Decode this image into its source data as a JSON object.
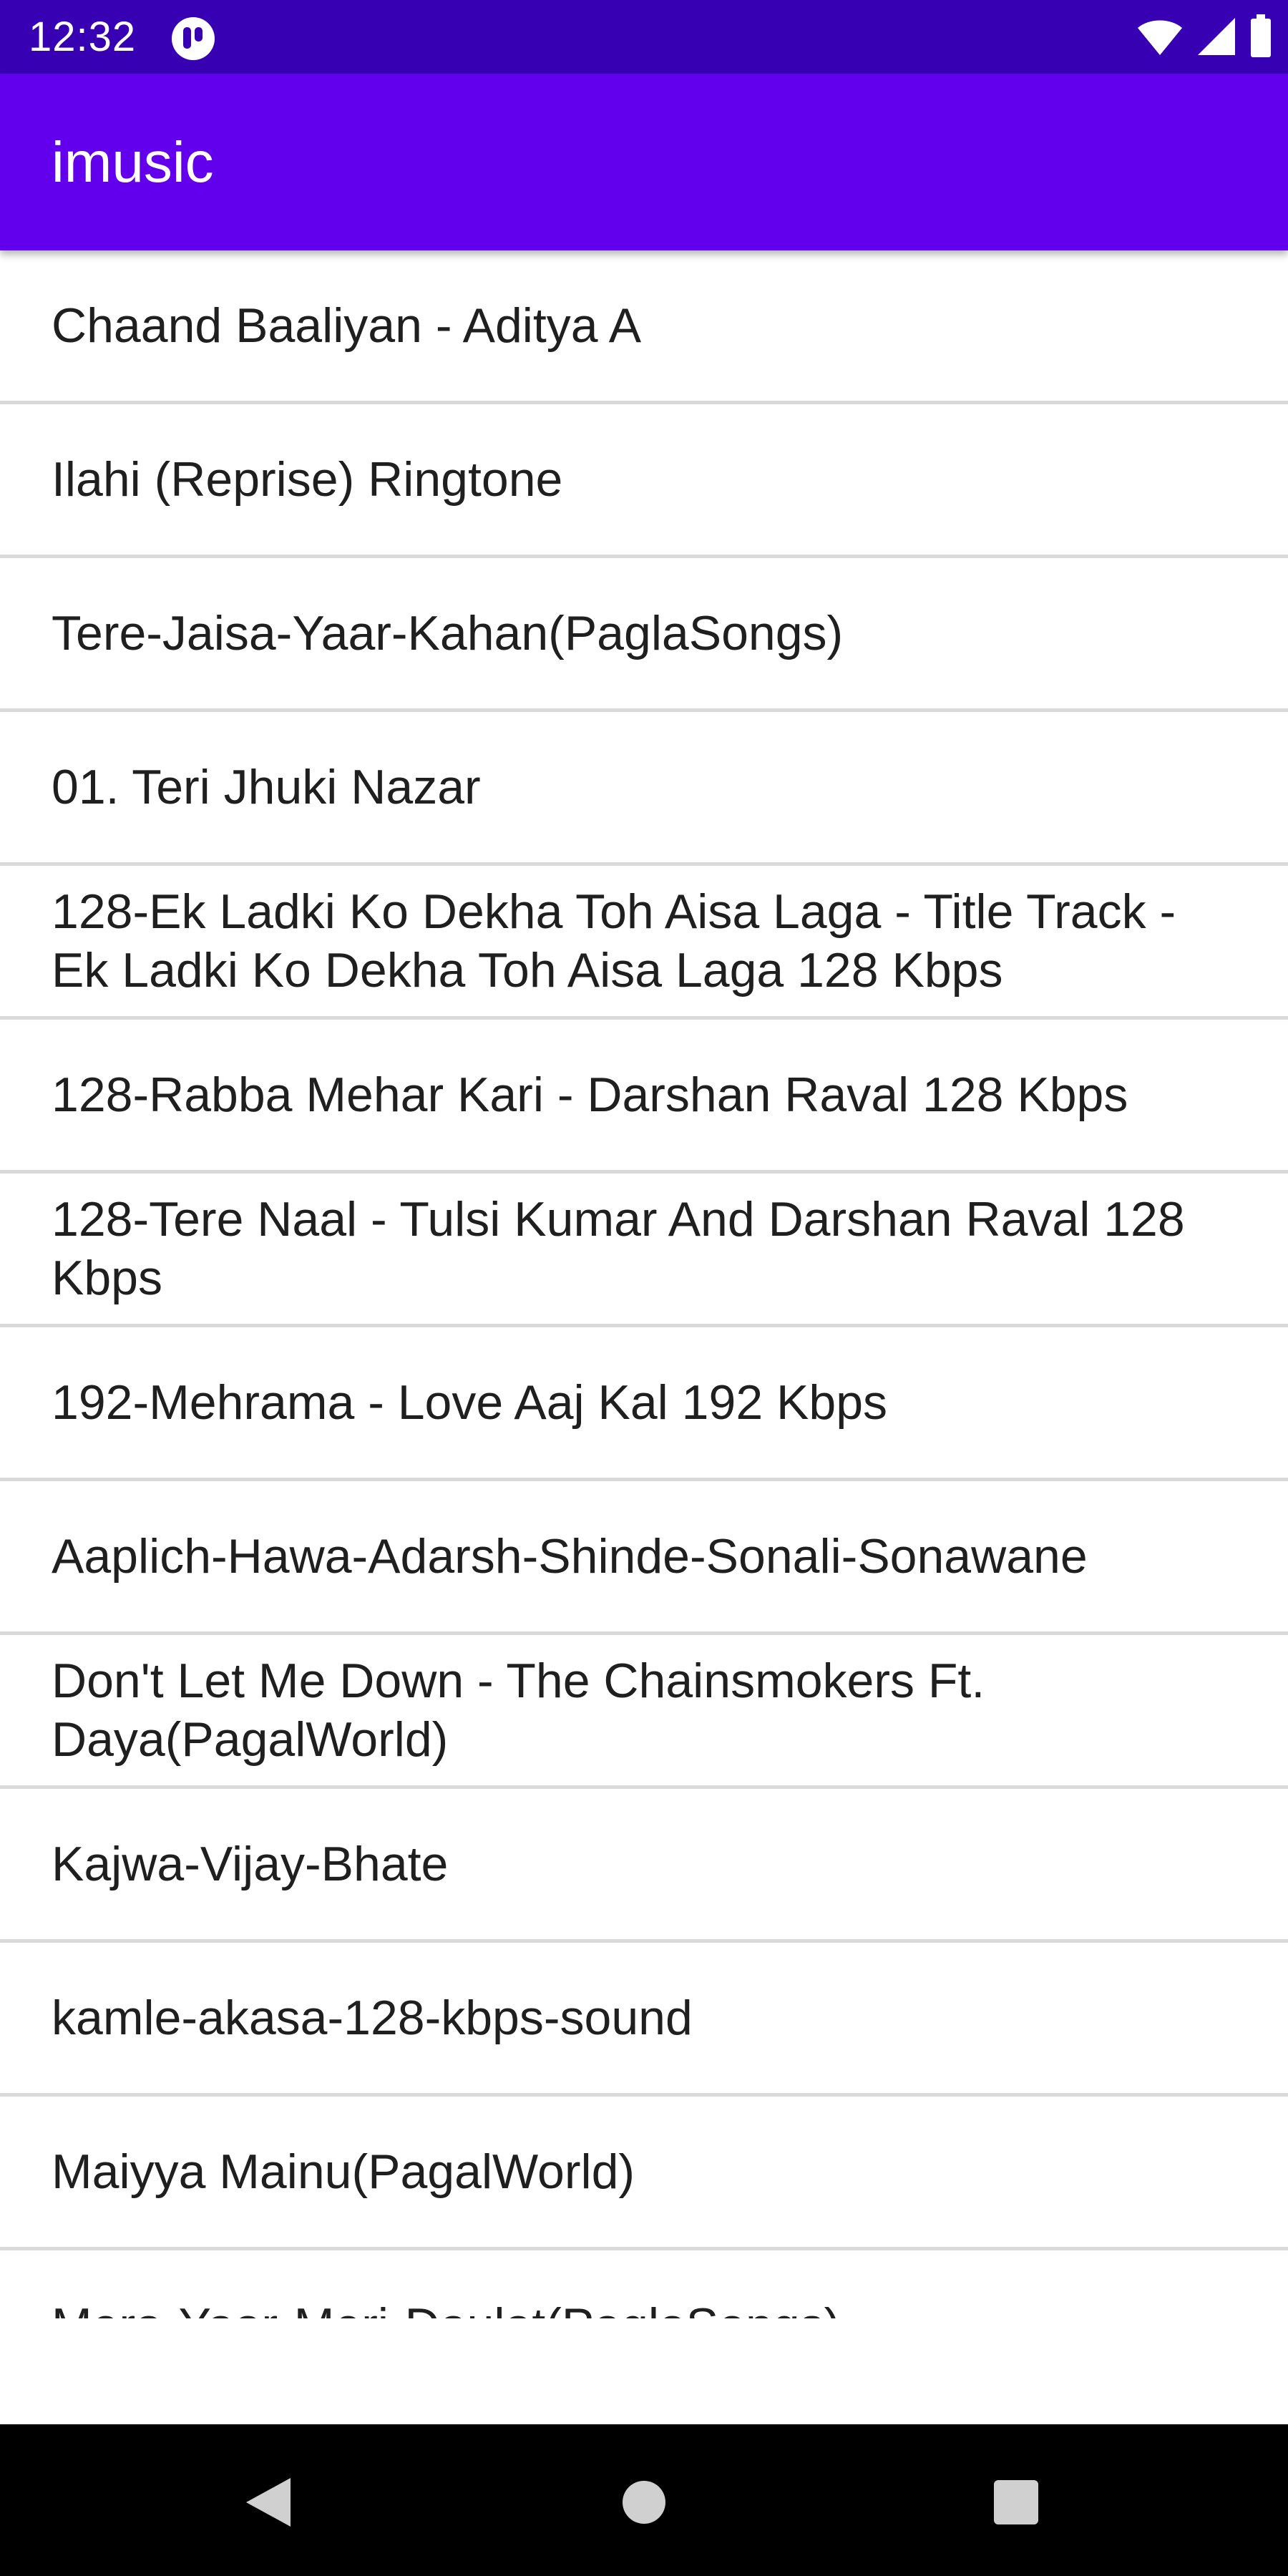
{
  "status_bar": {
    "time": "12:32",
    "icons": [
      "app-notification-icon",
      "wifi-icon",
      "cellular-signal-icon",
      "battery-icon"
    ],
    "background": "#3700b3"
  },
  "app_bar": {
    "title": "imusic",
    "background": "#6200ee"
  },
  "songs": [
    {
      "title": "Chaand Baaliyan - Aditya A"
    },
    {
      "title": "Ilahi (Reprise) Ringtone"
    },
    {
      "title": "Tere-Jaisa-Yaar-Kahan(PaglaSongs)"
    },
    {
      "title": "01. Teri Jhuki Nazar"
    },
    {
      "title": "128-Ek Ladki Ko Dekha Toh Aisa Laga - Title Track - Ek Ladki Ko Dekha Toh Aisa Laga 128 Kbps"
    },
    {
      "title": "128-Rabba Mehar Kari - Darshan Raval 128 Kbps"
    },
    {
      "title": "128-Tere Naal - Tulsi Kumar And Darshan Raval 128 Kbps"
    },
    {
      "title": "192-Mehrama - Love Aaj Kal 192 Kbps"
    },
    {
      "title": "Aaplich-Hawa-Adarsh-Shinde-Sonali-Sonawane"
    },
    {
      "title": "Don't Let Me Down - The Chainsmokers Ft. Daya(PagalWorld)"
    },
    {
      "title": "Kajwa-Vijay-Bhate"
    },
    {
      "title": "kamle-akasa-128-kbps-sound"
    },
    {
      "title": "Maiyya Mainu(PagalWorld)"
    },
    {
      "title": "Mera-Yaar-Meri-Daulat(PaglaSongs)"
    }
  ],
  "nav_bar": {
    "buttons": [
      "back-icon",
      "home-icon",
      "recents-icon"
    ]
  }
}
